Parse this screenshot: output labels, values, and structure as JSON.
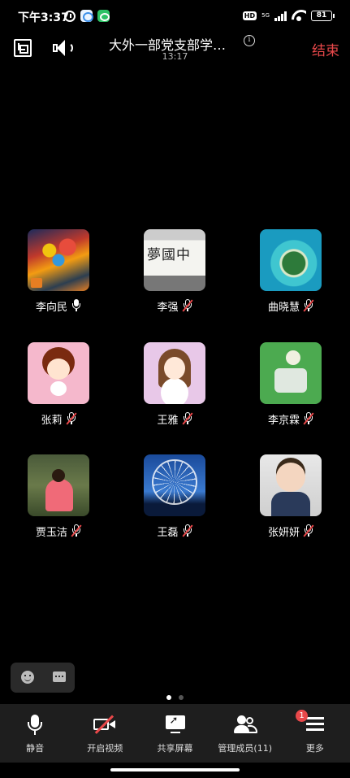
{
  "status_bar": {
    "time": "下午3:37",
    "hd": "HD",
    "network": "5G",
    "battery": "81"
  },
  "header": {
    "title": "大外一部党支部学…",
    "duration": "13:17",
    "end_label": "结束",
    "info": "i"
  },
  "participants": [
    {
      "name": "李向民",
      "muted": false,
      "avatar": "painting"
    },
    {
      "name": "李强",
      "muted": true,
      "avatar": "calligraphy",
      "avatar_text": "夢國中"
    },
    {
      "name": "曲晓慧",
      "muted": true,
      "avatar": "island"
    },
    {
      "name": "张莉",
      "muted": true,
      "avatar": "cartoon-girl"
    },
    {
      "name": "王雅",
      "muted": true,
      "avatar": "cartoon-glasses"
    },
    {
      "name": "李京霖",
      "muted": true,
      "avatar": "green-sketch"
    },
    {
      "name": "贾玉洁",
      "muted": true,
      "avatar": "girl-photo"
    },
    {
      "name": "王磊",
      "muted": true,
      "avatar": "ferris-wheel"
    },
    {
      "name": "张妍妍",
      "muted": true,
      "avatar": "baby-photo"
    }
  ],
  "pager": {
    "pages": 2,
    "current": 1
  },
  "toolbar": {
    "mute": "静音",
    "video": "开启视频",
    "share": "共享屏幕",
    "members": "管理成员(11)",
    "more": "更多",
    "more_badge": "1"
  },
  "colors": {
    "accent_red": "#e8484a",
    "background": "#000000",
    "toolbar_bg": "#1e1e1e"
  }
}
